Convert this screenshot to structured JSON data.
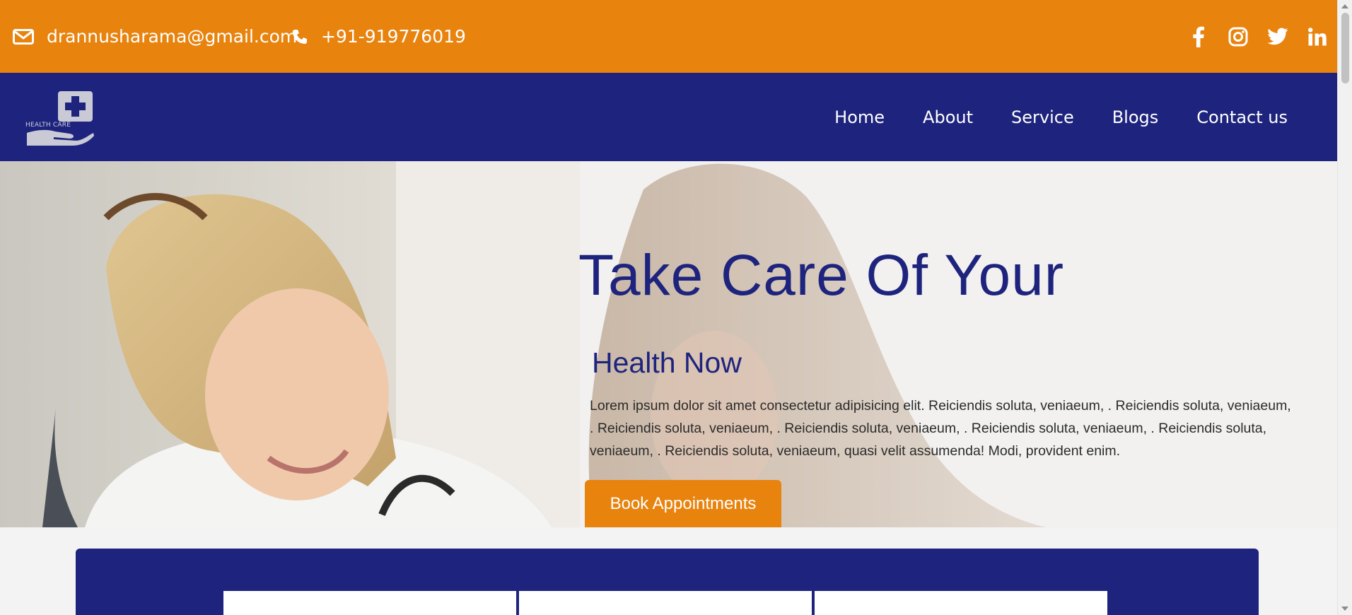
{
  "topbar": {
    "email": "drannusharama@gmail.com",
    "phone": "+91-919776019",
    "email_icon": "envelope-icon",
    "phone_icon": "phone-icon",
    "social": [
      "facebook-icon",
      "instagram-icon",
      "twitter-icon",
      "linkedin-icon"
    ],
    "color": "#e8830e"
  },
  "navbar": {
    "logo_text": "HEALTH CARE",
    "items": [
      {
        "label": "Home"
      },
      {
        "label": "About"
      },
      {
        "label": "Service"
      },
      {
        "label": "Blogs"
      },
      {
        "label": "Contact us"
      }
    ],
    "color": "#1e247d"
  },
  "hero": {
    "title": "Take Care Of Your",
    "subtitle": "Health Now",
    "text": "Lorem ipsum dolor sit amet consectetur adipisicing elit. Reiciendis soluta, veniaeum, . Reiciendis soluta, veniaeum, . Reiciendis soluta, veniaeum, . Reiciendis soluta, veniaeum, . Reiciendis soluta, veniaeum, . Reiciendis soluta, veniaeum, . Reiciendis soluta, veniaeum, quasi velit assumenda! Modi, provident enim.",
    "button_label": "Book Appointments"
  }
}
